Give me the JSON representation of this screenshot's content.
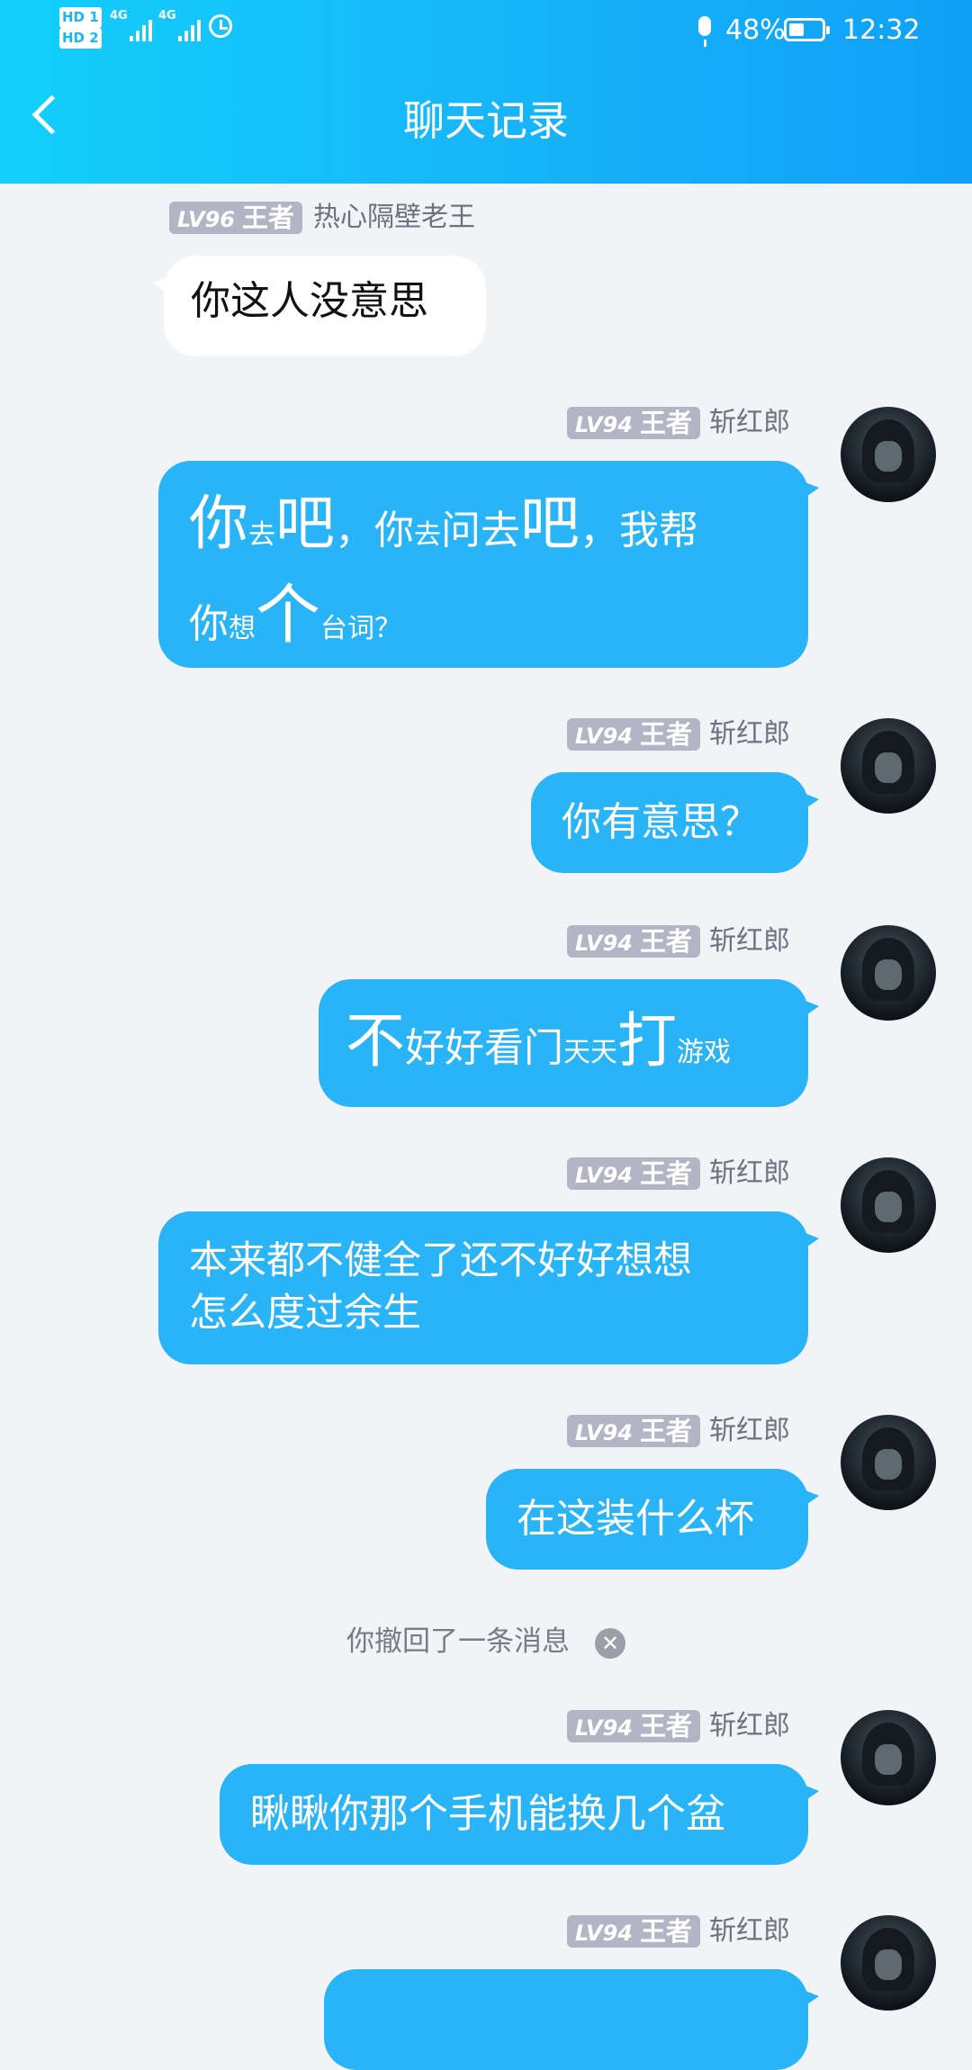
{
  "status_bar": {
    "sim1": "HD 1",
    "sim2": "HD 2",
    "net1": "4G",
    "net2": "4G",
    "battery_percent": "48%",
    "battery_level": 0.48,
    "time": "12:32",
    "icons": [
      "signal-icon",
      "alarm-icon",
      "mic-icon",
      "battery-icon"
    ]
  },
  "header": {
    "title": "聊天记录",
    "back_icon": "chevron-left-icon"
  },
  "colors": {
    "header_gradient": [
      "#12d0fb",
      "#0fa0f6"
    ],
    "my_bubble": "#28b4f6",
    "other_bubble": "#ffffff",
    "badge": "#b3b5c5",
    "background": "#f2f3f7"
  },
  "messages": [
    {
      "side": "other",
      "level": "LV96",
      "rank": "王者",
      "name": "热心隔壁老王",
      "text": "你这人没意思"
    },
    {
      "side": "me",
      "level": "LV94",
      "rank": "王者",
      "name": "斩红郎",
      "text": "你去吧，你去问去吧，我帮你想个台词？",
      "segments": [
        [
          "你",
          "big"
        ],
        [
          "去",
          "small"
        ],
        [
          "吧",
          "big"
        ],
        [
          "，你",
          "mid"
        ],
        [
          "去",
          "small"
        ],
        [
          "问去",
          "mid"
        ],
        [
          "吧",
          "big"
        ],
        [
          "，我帮",
          "mid"
        ],
        [
          "你",
          "mid"
        ],
        [
          "想",
          "small"
        ],
        [
          "个",
          "huge"
        ],
        [
          "台词？",
          "small"
        ]
      ]
    },
    {
      "side": "me",
      "level": "LV94",
      "rank": "王者",
      "name": "斩红郎",
      "text": "你有意思？"
    },
    {
      "side": "me",
      "level": "LV94",
      "rank": "王者",
      "name": "斩红郎",
      "text": "不好好看门天天打游戏",
      "segments": [
        [
          "不",
          "big"
        ],
        [
          "好好看门",
          "mid"
        ],
        [
          "天天",
          "small"
        ],
        [
          "打",
          "big"
        ],
        [
          "游戏",
          "small"
        ]
      ]
    },
    {
      "side": "me",
      "level": "LV94",
      "rank": "王者",
      "name": "斩红郎",
      "line1": "本来都不健全了还不好好想想",
      "line2": "怎么度过余生"
    },
    {
      "side": "me",
      "level": "LV94",
      "rank": "王者",
      "name": "斩红郎",
      "text": "在这装什么杯"
    },
    {
      "side": "me",
      "level": "LV94",
      "rank": "王者",
      "name": "斩红郎",
      "text": "瞅瞅你那个手机能换几个盆"
    },
    {
      "side": "me",
      "level": "LV94",
      "rank": "王者",
      "name": "斩红郎"
    }
  ],
  "recall_notice": "你撤回了一条消息",
  "recall_dismiss_icon": "close-circle-icon"
}
